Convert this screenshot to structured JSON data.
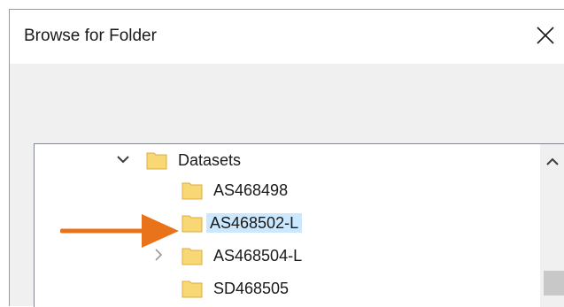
{
  "dialog": {
    "title": "Browse for Folder",
    "close_icon": "close-icon"
  },
  "tree": {
    "items": [
      {
        "label": "Datasets",
        "expanded": true,
        "level": 0,
        "icon": "folder-icon"
      },
      {
        "label": "AS468498",
        "level": 1,
        "icon": "folder-icon"
      },
      {
        "label": "AS468502-L",
        "level": 1,
        "selected": true,
        "icon": "folder-icon"
      },
      {
        "label": "AS468504-L",
        "level": 1,
        "expandable": true,
        "icon": "folder-icon"
      },
      {
        "label": "SD468505",
        "level": 1,
        "icon": "folder-icon"
      }
    ]
  },
  "annotation": {
    "arrow_color": "#e8731a",
    "icon": "arrow-right-icon"
  },
  "colors": {
    "selection": "#cce8ff",
    "folder_fill": "#f8d775",
    "folder_stroke": "#dcae3d"
  }
}
